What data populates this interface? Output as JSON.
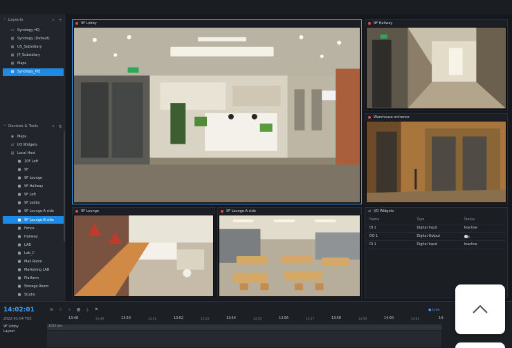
{
  "sidebar": {
    "layouts": {
      "title": "Layouts",
      "items": [
        {
          "label": "Synology HQ",
          "icon": "folder-icon"
        },
        {
          "label": "Synology (Default)",
          "icon": "layout-icon"
        },
        {
          "label": "US_Subsidiary",
          "icon": "layout-icon"
        },
        {
          "label": "JP_Subsidiary",
          "icon": "layout-icon"
        },
        {
          "label": "Maps",
          "icon": "layout-icon"
        },
        {
          "label": "Synology_HQ",
          "icon": "layout-icon",
          "selected": true
        }
      ]
    },
    "devices": {
      "title": "Devices & Tools",
      "items": [
        {
          "label": "Maps",
          "icon": "map-icon"
        },
        {
          "label": "I/O Widgets",
          "icon": "io-icon"
        },
        {
          "label": "Local Host",
          "icon": "host-icon"
        },
        {
          "label": "10F Left",
          "icon": "camera-icon"
        },
        {
          "label": "9F",
          "icon": "camera-icon"
        },
        {
          "label": "9F Lounge",
          "icon": "camera-icon"
        },
        {
          "label": "9F Hallway",
          "icon": "camera-icon"
        },
        {
          "label": "9F Left",
          "icon": "camera-icon"
        },
        {
          "label": "9F Lobby",
          "icon": "camera-icon"
        },
        {
          "label": "9F Lounge-A side",
          "icon": "camera-icon"
        },
        {
          "label": "9F Lounge-B side",
          "icon": "camera-icon",
          "selected": true
        },
        {
          "label": "Fence",
          "icon": "camera-icon"
        },
        {
          "label": "Hallway",
          "icon": "camera-icon"
        },
        {
          "label": "LAB",
          "icon": "camera-icon"
        },
        {
          "label": "Lab_C",
          "icon": "camera-icon"
        },
        {
          "label": "Mail Room",
          "icon": "camera-icon"
        },
        {
          "label": "Marketing LAB",
          "icon": "camera-icon"
        },
        {
          "label": "Platform",
          "icon": "camera-icon"
        },
        {
          "label": "Storage Room",
          "icon": "camera-icon"
        },
        {
          "label": "Studio",
          "icon": "camera-icon"
        }
      ]
    }
  },
  "tiles": {
    "lobby": "9F Lobby",
    "hallway": "9F Hallway",
    "warehouse": "Warehouse entrance",
    "lounge": "9F Lounge",
    "lounge_a": "9F Lounge-A side",
    "io": "I/O Widgets"
  },
  "io_widgets": {
    "headers": {
      "name": "Name",
      "type": "Type",
      "status": "Status"
    },
    "rows": [
      {
        "name": "DI 1",
        "type": "Digital Input",
        "status": "Inactive"
      },
      {
        "name": "DO 1",
        "type": "Digital Output",
        "status": ""
      },
      {
        "name": "DI 1",
        "type": "Digital Input",
        "status": "Inactive"
      }
    ]
  },
  "timeline": {
    "current_time": "14:02:01",
    "date": "2022-01-04 TUE",
    "camera": "9F Lobby",
    "layout": "Layout",
    "live": "● Live",
    "track_label": "2022-Jan",
    "ticks_major": [
      "13:48",
      "13:50",
      "13:52",
      "13:54",
      "13:56",
      "13:58",
      "14:00",
      "14:"
    ],
    "ticks_minor": [
      "13:49",
      "13:51",
      "13:53",
      "13:55",
      "13:57",
      "13:59",
      "14:01"
    ]
  },
  "colors": {
    "accent": "#1d8be6",
    "live": "#3fa0ff",
    "record": "#e0474c"
  }
}
